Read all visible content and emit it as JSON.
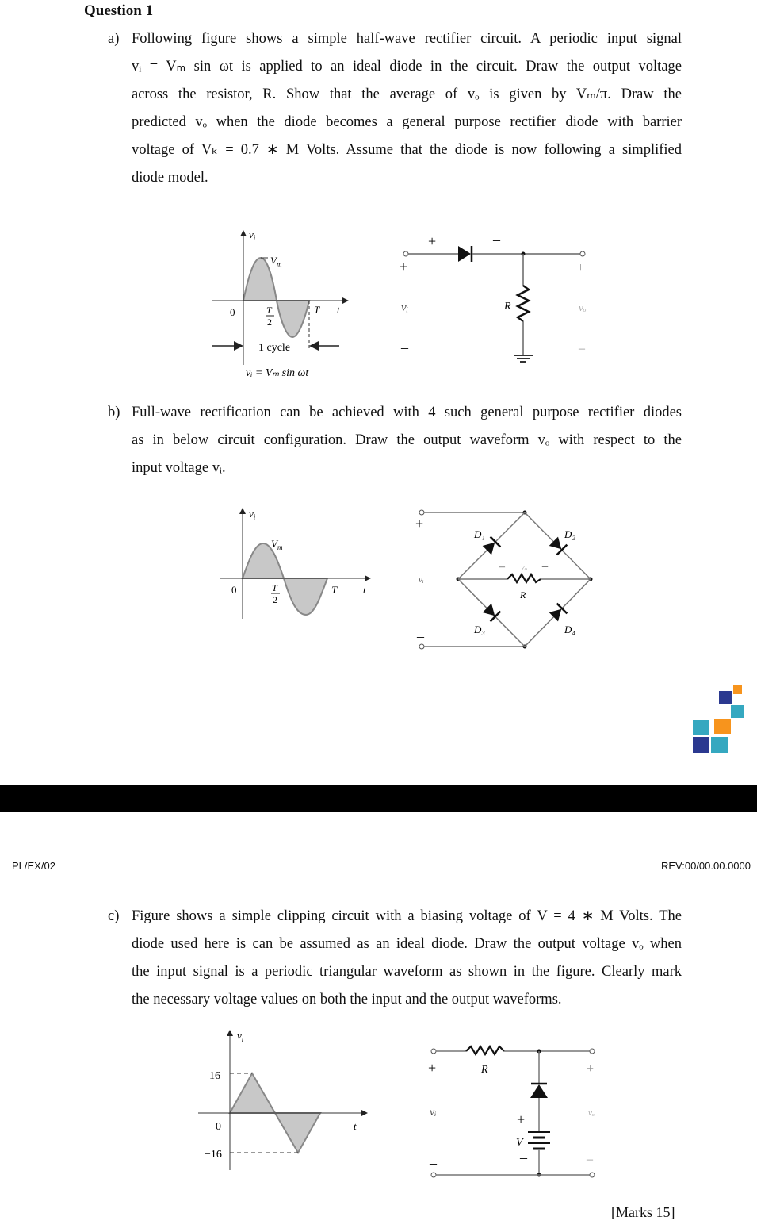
{
  "question": {
    "title": "Question 1",
    "marks": "[Marks 15]"
  },
  "part_a": {
    "label": "a)",
    "lines": [
      "Following figure shows a simple half-wave rectifier circuit. A periodic input signal",
      "vᵢ = Vₘ sin ωt is applied to an ideal diode in the circuit. Draw the output voltage",
      "across the resistor, R. Show that the average of vₒ is given by Vₘ/π. Draw the",
      "predicted vₒ when the diode becomes a general purpose rectifier diode with barrier",
      "voltage of Vₖ = 0.7 ∗ M Volts. Assume that the diode is now following a simplified",
      "diode model."
    ],
    "waveform": {
      "axis_y": "v",
      "axis_y_sub": "i",
      "axis_x": "t",
      "peak_label": "V",
      "peak_sub": "m",
      "origin": "0",
      "half_period_num": "T",
      "half_period_den": "2",
      "period": "T",
      "cycle_label": "1 cycle",
      "equation": "vᵢ = Vₘ sin ωt"
    },
    "circuit": {
      "in_plus": "+",
      "in_minus": "–",
      "in_label": "vᵢ",
      "diode_plus": "+",
      "diode_minus": "–",
      "resistor": "R",
      "out_plus": "+",
      "out_minus": "–",
      "out_label": "vₒ"
    }
  },
  "part_b": {
    "label": "b)",
    "lines": [
      "Full-wave rectification can be achieved with 4 such general purpose rectifier diodes",
      "as in below circuit configuration. Draw the output waveform vₒ with respect to the",
      "input voltage vᵢ."
    ],
    "waveform": {
      "axis_y": "v",
      "axis_y_sub": "i",
      "axis_x": "t",
      "peak_label": "V",
      "peak_sub": "m",
      "origin": "0",
      "half_period_num": "T",
      "half_period_den": "2",
      "period": "T"
    },
    "circuit": {
      "in_plus": "+",
      "in_minus": "–",
      "in_label": "vᵢ",
      "d1": "D₁",
      "d2": "D₂",
      "d3": "D₃",
      "d4": "D₄",
      "vo_minus": "–",
      "vo_label": "vₒ",
      "vo_plus": "+",
      "resistor": "R"
    }
  },
  "page_break": {
    "doc_code": "PL/EX/02",
    "revision": "REV:00/00.00.0000",
    "logo_colors": {
      "navy": "#2b3990",
      "teal": "#35a8c0",
      "orange": "#f7941d"
    }
  },
  "part_c": {
    "label": "c)",
    "lines": [
      "Figure shows a simple clipping circuit with a biasing voltage of V = 4 ∗ M Volts. The",
      "diode used here is can be assumed as an ideal diode. Draw the output voltage vₒ when",
      "the input signal is a periodic triangular waveform as shown in the figure. Clearly mark",
      "the necessary voltage values on both the input and the output waveforms."
    ],
    "waveform": {
      "axis_y": "v",
      "axis_y_sub": "i",
      "axis_x": "t",
      "peak_pos": "16",
      "peak_neg": "−16",
      "origin": "0"
    },
    "circuit": {
      "in_plus": "+",
      "in_minus": "–",
      "in_label": "vᵢ",
      "resistor": "R",
      "bat_plus": "+",
      "bat_label": "V",
      "bat_minus": "–",
      "out_plus": "+",
      "out_minus": "–",
      "out_label": "vₒ"
    }
  }
}
